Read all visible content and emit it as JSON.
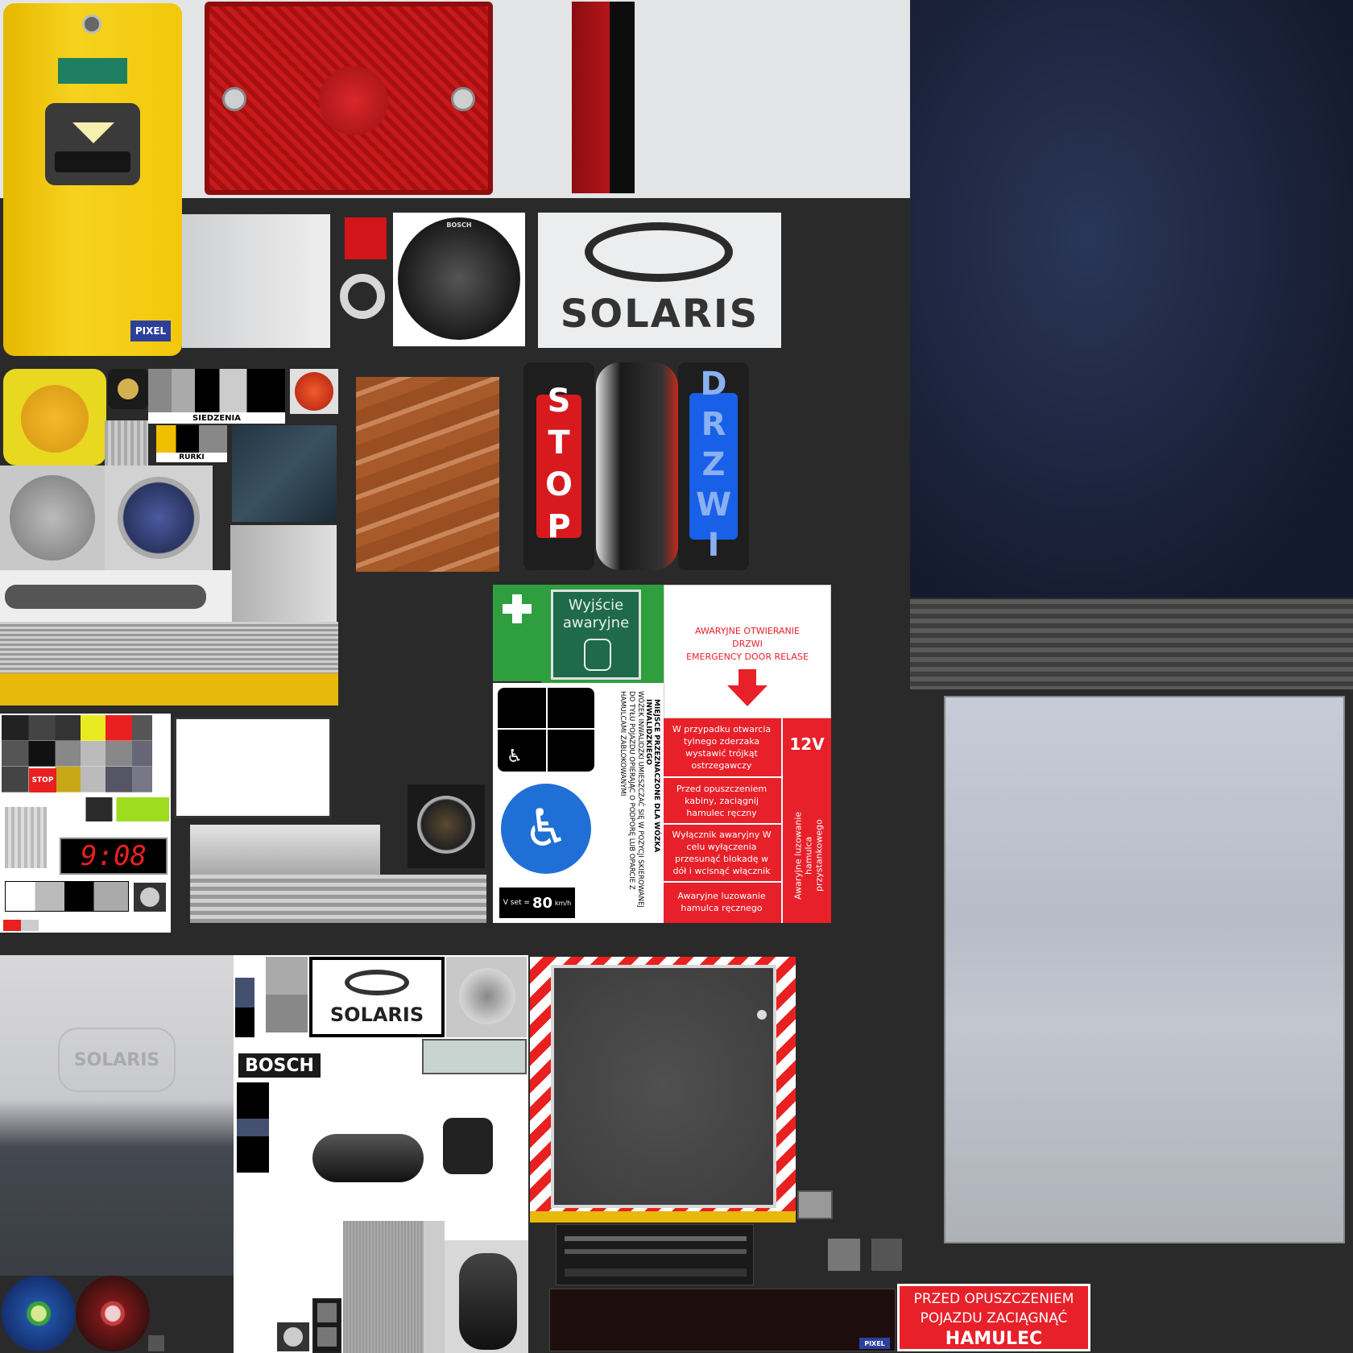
{
  "colors": {
    "background": "#2a2a2a",
    "yellow": "#f1c40f",
    "red": "#e8202a",
    "green": "#2e9e3e",
    "blue": "#1f6fd6",
    "navy": "#1c2540"
  },
  "validator": {
    "brand": "PIXEL"
  },
  "bosch_speaker": {
    "brand": "BOSCH"
  },
  "solaris_top": {
    "brand": "SOLARIS"
  },
  "small_labels": {
    "seats": "SIEDZENIA",
    "tubes": "RURKI",
    "stop_chip": "STOP"
  },
  "stop_button": {
    "text": "STOP"
  },
  "door_button": {
    "text": "DRZWI"
  },
  "emergency_exit": {
    "line1": "Wyjście",
    "line2": "awaryjne"
  },
  "emergency_door": {
    "line1": "AWARYJNE OTWIERANIE",
    "line2": "DRZWI",
    "line3": "EMERGENCY DOOR RELASE"
  },
  "warnings": {
    "bumper": "W przypadku otwarcia tylnego zderzaka wystawić trójkąt ostrzegawczy",
    "cabin": "Przed opuszczeniem kabiny, zaciągnij hamulec ręczny",
    "switch": "Wyłącznik awaryjny W celu wyłączenia przesunąć blokadę w dół i wcisnąć włącznik",
    "release": "Awaryjne luzowanie hamulca ręcznego",
    "voltage": "12V",
    "stop_brake": "Awaryjne luzowanie hamulca przystankowego"
  },
  "wheelchair": {
    "title": "MIEJSCE PRZEZNACZONE DLA WÓZKA INWALIDZKIEGO",
    "body": "WÓZEK INWALIDZKI UMIESZCZAĆ SIĘ W POZYCJI SKIEROWANEJ DO TYŁU POJAZDU OPIERAJĄC O PODPORĘ LUB OPARCIE Z HAMULCAMI ZABLOKOWANYMI"
  },
  "speed": {
    "prefix": "V set =",
    "value": "80",
    "unit": "km/h"
  },
  "clock": {
    "time": "9:08"
  },
  "solaris_mid": {
    "brand": "SOLARIS"
  },
  "seat_logo": {
    "brand": "SOLARIS"
  },
  "bosch_label": {
    "brand": "BOSCH"
  },
  "display_badge": {
    "brand": "PIXEL"
  },
  "brake_sign": {
    "line1": "PRZED OPUSZCZENIEM",
    "line2": "POJAZDU  ZACIĄGNĄĆ",
    "line3": "HAMULEC"
  }
}
